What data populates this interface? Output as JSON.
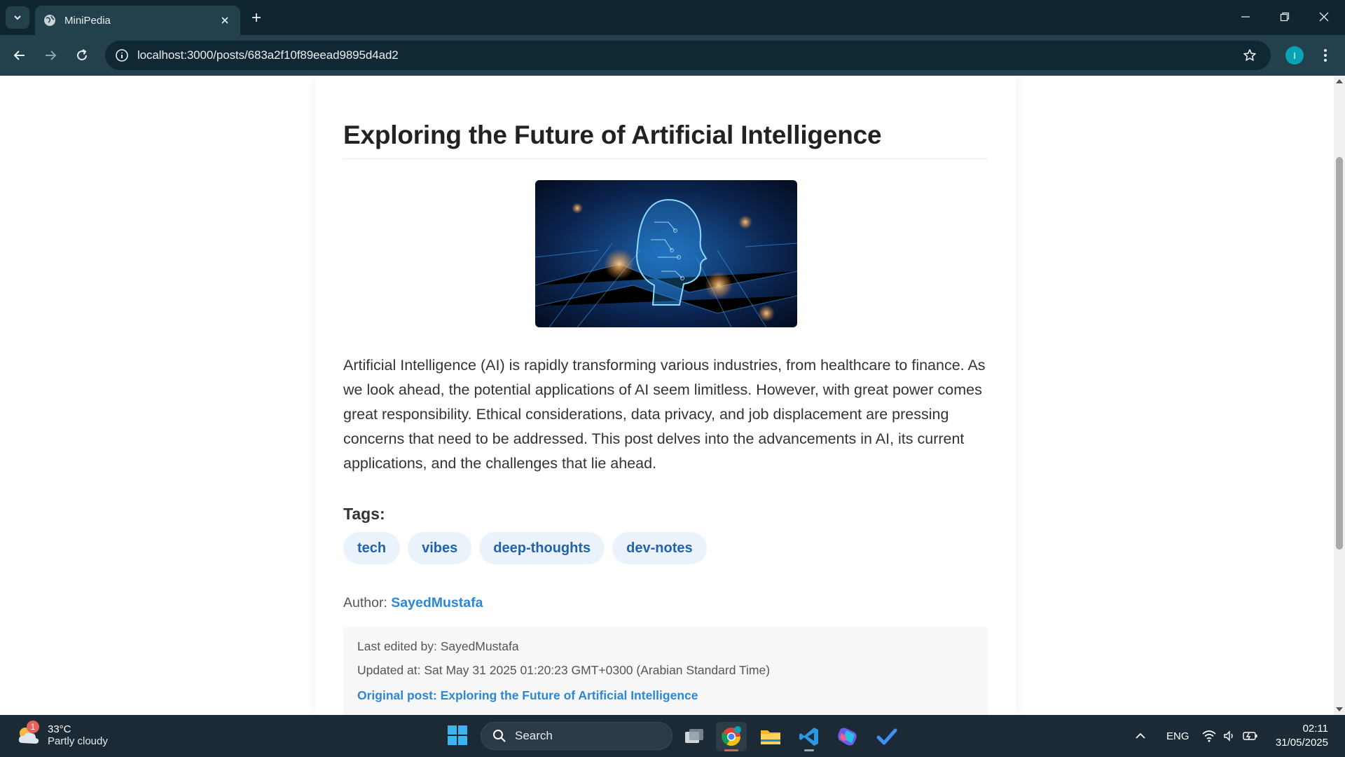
{
  "browser": {
    "tab_title": "MiniPedia",
    "url": "localhost:3000/posts/683a2f10f89eead9895d4ad2",
    "profile_initial": "I"
  },
  "post": {
    "title": "Exploring the Future of Artificial Intelligence",
    "body": "Artificial Intelligence (AI) is rapidly transforming various industries, from healthcare to finance. As we look ahead, the potential applications of AI seem limitless. However, with great power comes great responsibility. Ethical considerations, data privacy, and job displacement are pressing concerns that need to be addressed. This post delves into the advancements in AI, its current applications, and the challenges that lie ahead.",
    "tags_heading": "Tags:",
    "tags": [
      "tech",
      "vibes",
      "deep-thoughts",
      "dev-notes"
    ],
    "author_label": "Author:",
    "author": "SayedMustafa",
    "last_edited": "Last edited by: SayedMustafa",
    "updated_at": "Updated at: Sat May 31 2025 01:20:23 GMT+0300 (Arabian Standard Time)",
    "original_post": "Original post: Exploring the Future of Artificial Intelligence"
  },
  "taskbar": {
    "weather_temp": "33°C",
    "weather_desc": "Partly cloudy",
    "weather_badge": "1",
    "search_placeholder": "Search",
    "language": "ENG",
    "time": "02:11",
    "date": "31/05/2025"
  },
  "colors": {
    "tabstrip": "#0f2530",
    "toolbar": "#23414d",
    "link": "#2d86d6",
    "tag_bg": "#eaf3fb",
    "tag_text": "#1f63b0"
  }
}
